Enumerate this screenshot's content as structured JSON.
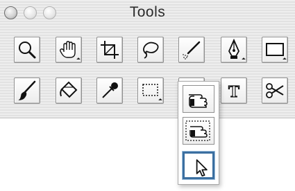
{
  "window": {
    "title": "Tools",
    "buttons": [
      "close",
      "minimize",
      "zoom"
    ]
  },
  "tools_row1": [
    {
      "icon": "zoom-magnifier-icon",
      "has_submenu": false
    },
    {
      "icon": "hand-pan-icon",
      "has_submenu": true
    },
    {
      "icon": "crop-icon",
      "has_submenu": false
    },
    {
      "icon": "lasso-icon",
      "has_submenu": false
    },
    {
      "icon": "airbrush-icon",
      "has_submenu": false
    },
    {
      "icon": "pen-nib-icon",
      "has_submenu": true
    },
    {
      "icon": "rectangle-shape-icon",
      "has_submenu": true
    }
  ],
  "tools_row2": [
    {
      "icon": "paintbrush-icon",
      "has_submenu": false
    },
    {
      "icon": "paint-bucket-icon",
      "has_submenu": false
    },
    {
      "icon": "eyedropper-icon",
      "has_submenu": false
    },
    {
      "icon": "marquee-select-icon",
      "has_submenu": true
    },
    {
      "icon": "object-select-icon",
      "has_submenu": true
    },
    {
      "icon": "text-tool-icon",
      "has_submenu": false
    },
    {
      "icon": "scissors-icon",
      "has_submenu": false
    }
  ],
  "text_tool_glyph": "T",
  "popup_menu": {
    "items": [
      {
        "icon": "hand-pointer-icon",
        "selected": false
      },
      {
        "icon": "hand-pointer-marquee-icon",
        "selected": false
      },
      {
        "icon": "arrow-pointer-icon",
        "selected": true
      }
    ]
  },
  "colors": {
    "selection_border": "#3b6fa0",
    "palette_background": "#e8e8e8"
  }
}
